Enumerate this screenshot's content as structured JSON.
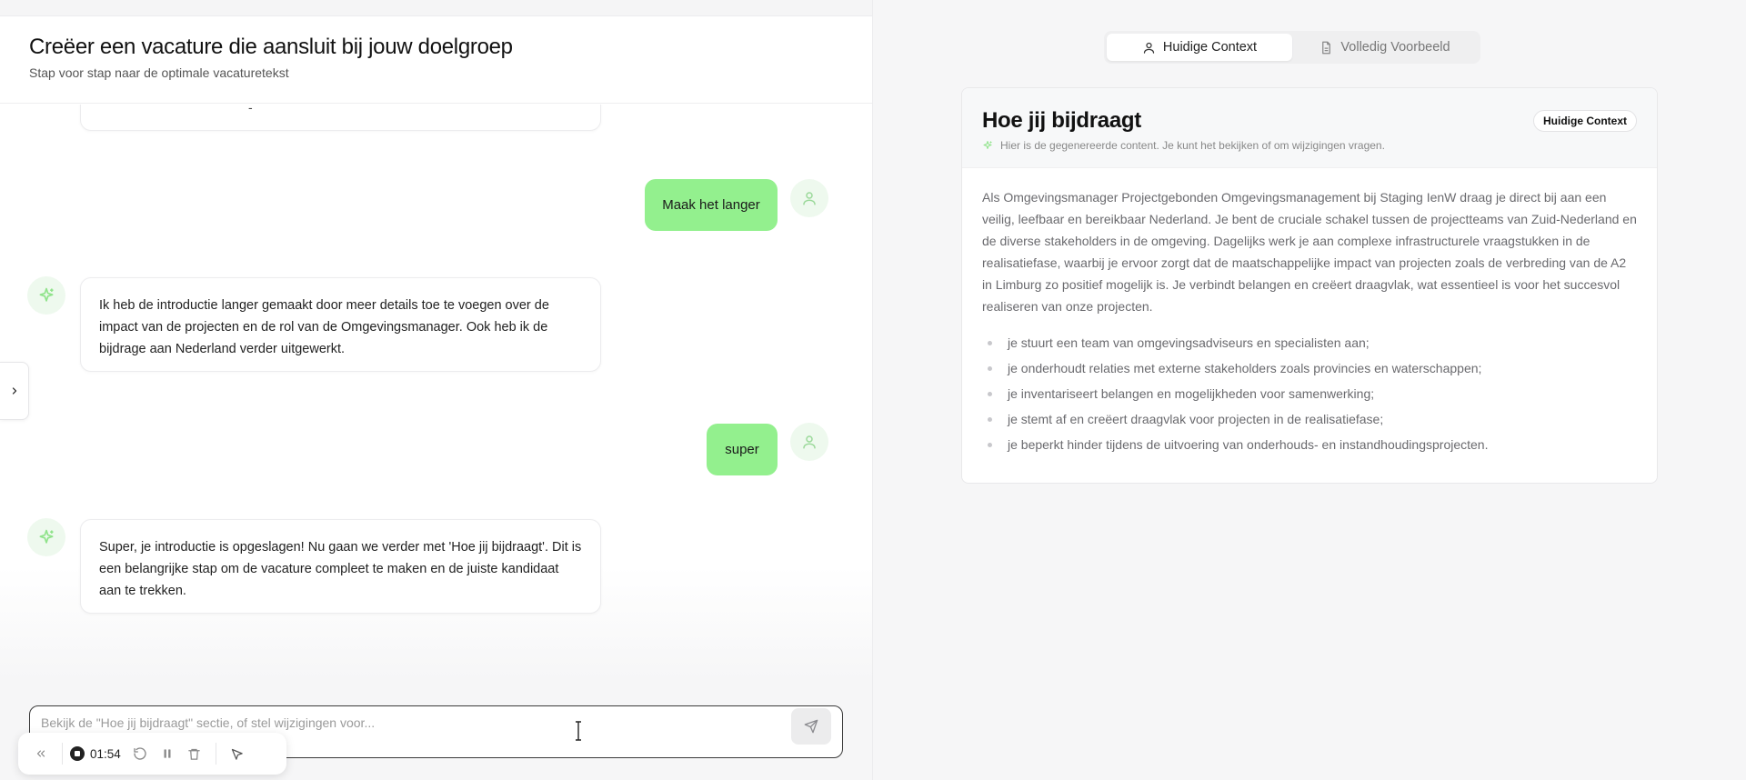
{
  "header": {
    "title": "Creëer een vacature die aansluit bij jouw doelgroep",
    "subtitle": "Stap voor stap naar de optimale vacaturetekst"
  },
  "chat": {
    "truncated_fragment": "-",
    "messages": [
      {
        "role": "user",
        "text": "Maak het langer"
      },
      {
        "role": "assistant",
        "text": "Ik heb de introductie langer gemaakt door meer details toe te voegen over de impact van de projecten en de rol van de Omgevingsmanager. Ook heb ik de bijdrage aan Nederland verder uitgewerkt."
      },
      {
        "role": "user",
        "text": "super"
      },
      {
        "role": "assistant",
        "text": "Super, je introductie is opgeslagen! Nu gaan we verder met 'Hoe jij bijdraagt'. Dit is een belangrijke stap om de vacature compleet te maken en de juiste kandidaat aan te trekken."
      }
    ]
  },
  "composer": {
    "placeholder": "Bekijk de \"Hoe jij bijdraagt\" sectie, of stel wijzigingen voor...",
    "value": ""
  },
  "recorder": {
    "time": "01:54"
  },
  "tabs": [
    {
      "label": "Huidige Context",
      "icon": "user-icon",
      "active": true
    },
    {
      "label": "Volledig Voorbeeld",
      "icon": "document-icon",
      "active": false
    }
  ],
  "preview": {
    "title": "Hoe jij bijdraagt",
    "badge": "Huidige Context",
    "subtitle": "Hier is de gegenereerde content. Je kunt het bekijken of om wijzigingen vragen.",
    "paragraph": "Als Omgevingsmanager Projectgebonden Omgevingsmanagement bij Staging IenW draag je direct bij aan een veilig, leefbaar en bereikbaar Nederland. Je bent de cruciale schakel tussen de projectteams van Zuid-Nederland en de diverse stakeholders in de omgeving. Dagelijks werk je aan complexe infrastructurele vraagstukken in de realisatiefase, waarbij je ervoor zorgt dat de maatschappelijke impact van projecten zoals de verbreding van de A2 in Limburg zo positief mogelijk is. Je verbindt belangen en creëert draagvlak, wat essentieel is voor het succesvol realiseren van onze projecten.",
    "bullets": [
      "je stuurt een team van omgevingsadviseurs en specialisten aan;",
      "je onderhoudt relaties met externe stakeholders zoals provincies en waterschappen;",
      "je inventariseert belangen en mogelijkheden voor samenwerking;",
      "je stemt af en creëert draagvlak voor projecten in de realisatiefase;",
      "je beperkt hinder tijdens de uitvoering van onderhouds- en instandhoudingsprojecten."
    ]
  },
  "colors": {
    "user_bubble": "#93f08e",
    "accent_green": "#8fe38a"
  }
}
